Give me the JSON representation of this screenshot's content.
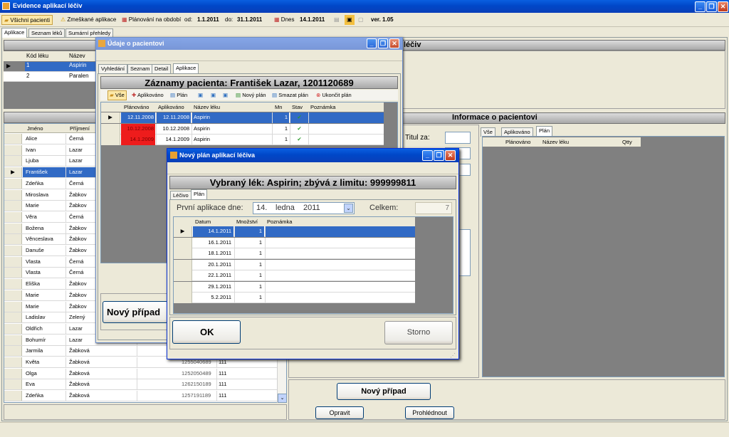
{
  "app": {
    "title": "Evidence aplikací léčiv"
  },
  "toolbar": {
    "all_patients": "Všichni pacienti",
    "missed": "Zmeškané aplikace",
    "planning": "Plánování na období",
    "from_label": "od:",
    "from_value": "1.1.2011",
    "to_label": "do:",
    "to_value": "31.1.2011",
    "today_label": "Dnes",
    "today_value": "14.1.2011",
    "version": "ver. 1.05"
  },
  "main_tabs": [
    "Aplikace",
    "Seznam léků",
    "Sumární přehledy"
  ],
  "drugs": {
    "title": "léčiv",
    "columns": [
      "Kód léku",
      "Název"
    ],
    "rows": [
      [
        "1",
        "Aspirin"
      ],
      [
        "2",
        "Paralen"
      ]
    ]
  },
  "patients": {
    "columns": [
      "Jméno",
      "Příjmení"
    ],
    "rows": [
      {
        "first": "Alice",
        "last": "Černá",
        "code": "",
        "num": ""
      },
      {
        "first": "Ivan",
        "last": "Lazar",
        "code": "",
        "num": ""
      },
      {
        "first": "Ljuba",
        "last": "Lazar",
        "code": "",
        "num": ""
      },
      {
        "first": "František",
        "last": "Lazar",
        "code": "",
        "num": ""
      },
      {
        "first": "Zdeňka",
        "last": "Černá",
        "code": "",
        "num": ""
      },
      {
        "first": "Miroslava",
        "last": "Žabkov",
        "code": "",
        "num": ""
      },
      {
        "first": "Marie",
        "last": "Žabkov",
        "code": "",
        "num": ""
      },
      {
        "first": "Věra",
        "last": "Černá",
        "code": "",
        "num": ""
      },
      {
        "first": "Božena",
        "last": "Žabkov",
        "code": "",
        "num": ""
      },
      {
        "first": "Věnceslava",
        "last": "Žabkov",
        "code": "",
        "num": ""
      },
      {
        "first": "Danuše",
        "last": "Žabkov",
        "code": "",
        "num": ""
      },
      {
        "first": "Vlasta",
        "last": "Černá",
        "code": "",
        "num": ""
      },
      {
        "first": "Vlasta",
        "last": "Černá",
        "code": "",
        "num": ""
      },
      {
        "first": "Eliška",
        "last": "Žabkov",
        "code": "",
        "num": ""
      },
      {
        "first": "Marie",
        "last": "Žabkov",
        "code": "",
        "num": ""
      },
      {
        "first": "Marie",
        "last": "Žabkov",
        "code": "",
        "num": ""
      },
      {
        "first": "Ladislav",
        "last": "Zelený",
        "code": "",
        "num": ""
      },
      {
        "first": "Oldřich",
        "last": "Lazar",
        "code": "",
        "num": ""
      },
      {
        "first": "Bohumír",
        "last": "Lazar",
        "code": "",
        "num": ""
      },
      {
        "first": "Jarmila",
        "last": "Žabková",
        "code": "",
        "num": ""
      },
      {
        "first": "Květa",
        "last": "Žabková",
        "code": "1255040689",
        "num": "111"
      },
      {
        "first": "Olga",
        "last": "Žabková",
        "code": "1252050489",
        "num": "111"
      },
      {
        "first": "Eva",
        "last": "Žabková",
        "code": "1262150189",
        "num": "111"
      },
      {
        "first": "Zdeňka",
        "last": "Žabková",
        "code": "1257191189",
        "num": "111"
      }
    ]
  },
  "info": {
    "title": "Informace o pacientovi",
    "titul_label": "Titul za:",
    "tabs": [
      "Vše",
      "Aplikováno",
      "Plán"
    ],
    "columns": [
      "Plánováno",
      "Název léku",
      "Qtty"
    ],
    "new_case": "Nový případ",
    "edit": "Opravit",
    "view": "Prohlédnout"
  },
  "patient_window": {
    "title": "Údaje o pacientovi",
    "tabs": [
      "Vyhledání",
      "Seznam",
      "Detail",
      "Aplikace"
    ],
    "header": "Záznamy pacienta: František Lazar, 1201120689",
    "toolbar": [
      "Vše",
      "Aplikováno",
      "Plán",
      "Nový plán",
      "Smazat plán",
      "Ukončit plán"
    ],
    "columns": [
      "Plánováno",
      "Aplikováno",
      "Název léku",
      "Mn",
      "Stav",
      "Poznámka"
    ],
    "rows": [
      {
        "planned": "12.11.2008",
        "applied": "12.11.2008",
        "drug": "Aspirin",
        "qty": "1"
      },
      {
        "planned": "10.12.2008",
        "applied": "10.12.2008",
        "drug": "Aspirin",
        "qty": "1"
      },
      {
        "planned": "14.1.2009",
        "applied": "14.1.2009",
        "drug": "Aspirin",
        "qty": "1"
      }
    ],
    "new_case": "Nový případ"
  },
  "plan_dialog": {
    "title": "Nový plán aplikací léčiva",
    "header": "Vybraný lék: Aspirin;  zbývá z limitu: 999999811",
    "tabs": [
      "Léčivo",
      "Plán"
    ],
    "first_label": "První aplikace dne:",
    "first_day": "14.",
    "first_month": "ledna",
    "first_year": "2011",
    "total_label": "Celkem:",
    "total_value": "7",
    "columns": [
      "Datum",
      "Množství",
      "Poznámka"
    ],
    "rows": [
      {
        "date": "14.1.2011",
        "qty": "1"
      },
      {
        "date": "16.1.2011",
        "qty": "1"
      },
      {
        "date": "18.1.2011",
        "qty": "1"
      },
      {
        "date": "20.1.2011",
        "qty": "1"
      },
      {
        "date": "22.1.2011",
        "qty": "1"
      },
      {
        "date": "29.1.2011",
        "qty": "1"
      },
      {
        "date": "5.2.2011",
        "qty": "1"
      }
    ],
    "ok": "OK",
    "cancel": "Storno"
  }
}
